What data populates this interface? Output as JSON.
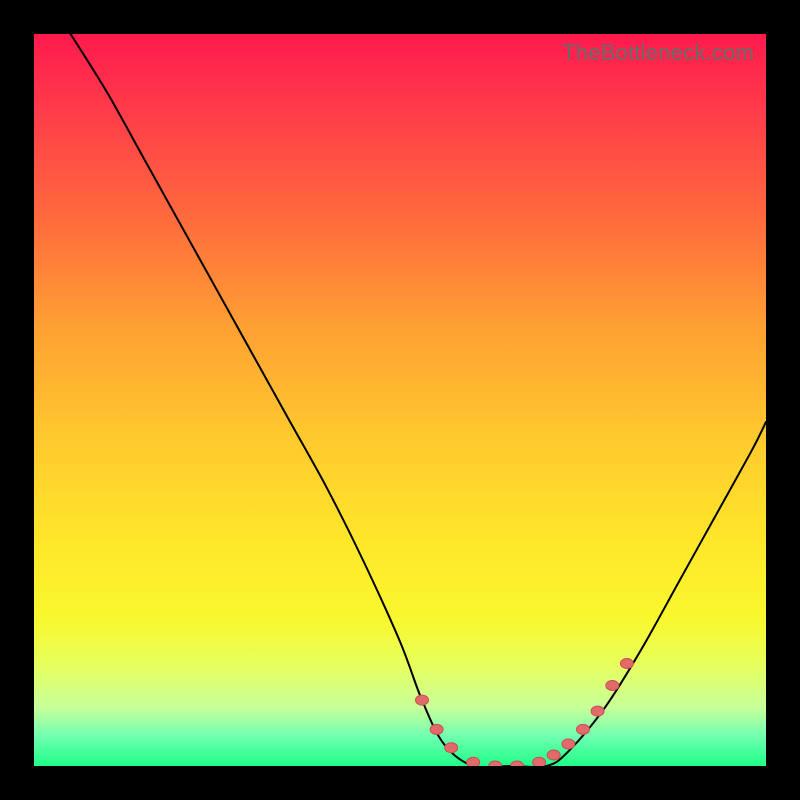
{
  "watermark": "TheBottleneck.com",
  "chart_data": {
    "type": "line",
    "title": "",
    "xlabel": "",
    "ylabel": "",
    "xlim": [
      0,
      100
    ],
    "ylim": [
      0,
      100
    ],
    "series": [
      {
        "name": "curve",
        "x": [
          5,
          10,
          15,
          20,
          25,
          30,
          35,
          40,
          45,
          50,
          53,
          56,
          60,
          65,
          70,
          73,
          78,
          83,
          88,
          93,
          98,
          100
        ],
        "y": [
          100,
          92,
          83,
          74,
          65,
          56,
          47,
          38,
          28,
          17,
          9,
          3,
          0,
          0,
          0,
          2,
          8,
          16,
          25,
          34,
          43,
          47
        ]
      }
    ],
    "markers": {
      "name": "highlight-dots",
      "x": [
        53,
        55,
        57,
        60,
        63,
        66,
        69,
        71,
        73,
        75,
        77,
        79,
        81
      ],
      "y": [
        9,
        5,
        2.5,
        0.5,
        0,
        0,
        0.5,
        1.5,
        3,
        5,
        7.5,
        11,
        14
      ]
    },
    "background_gradient": [
      "#ff1a4d",
      "#ffe82a",
      "#1eff88"
    ]
  }
}
